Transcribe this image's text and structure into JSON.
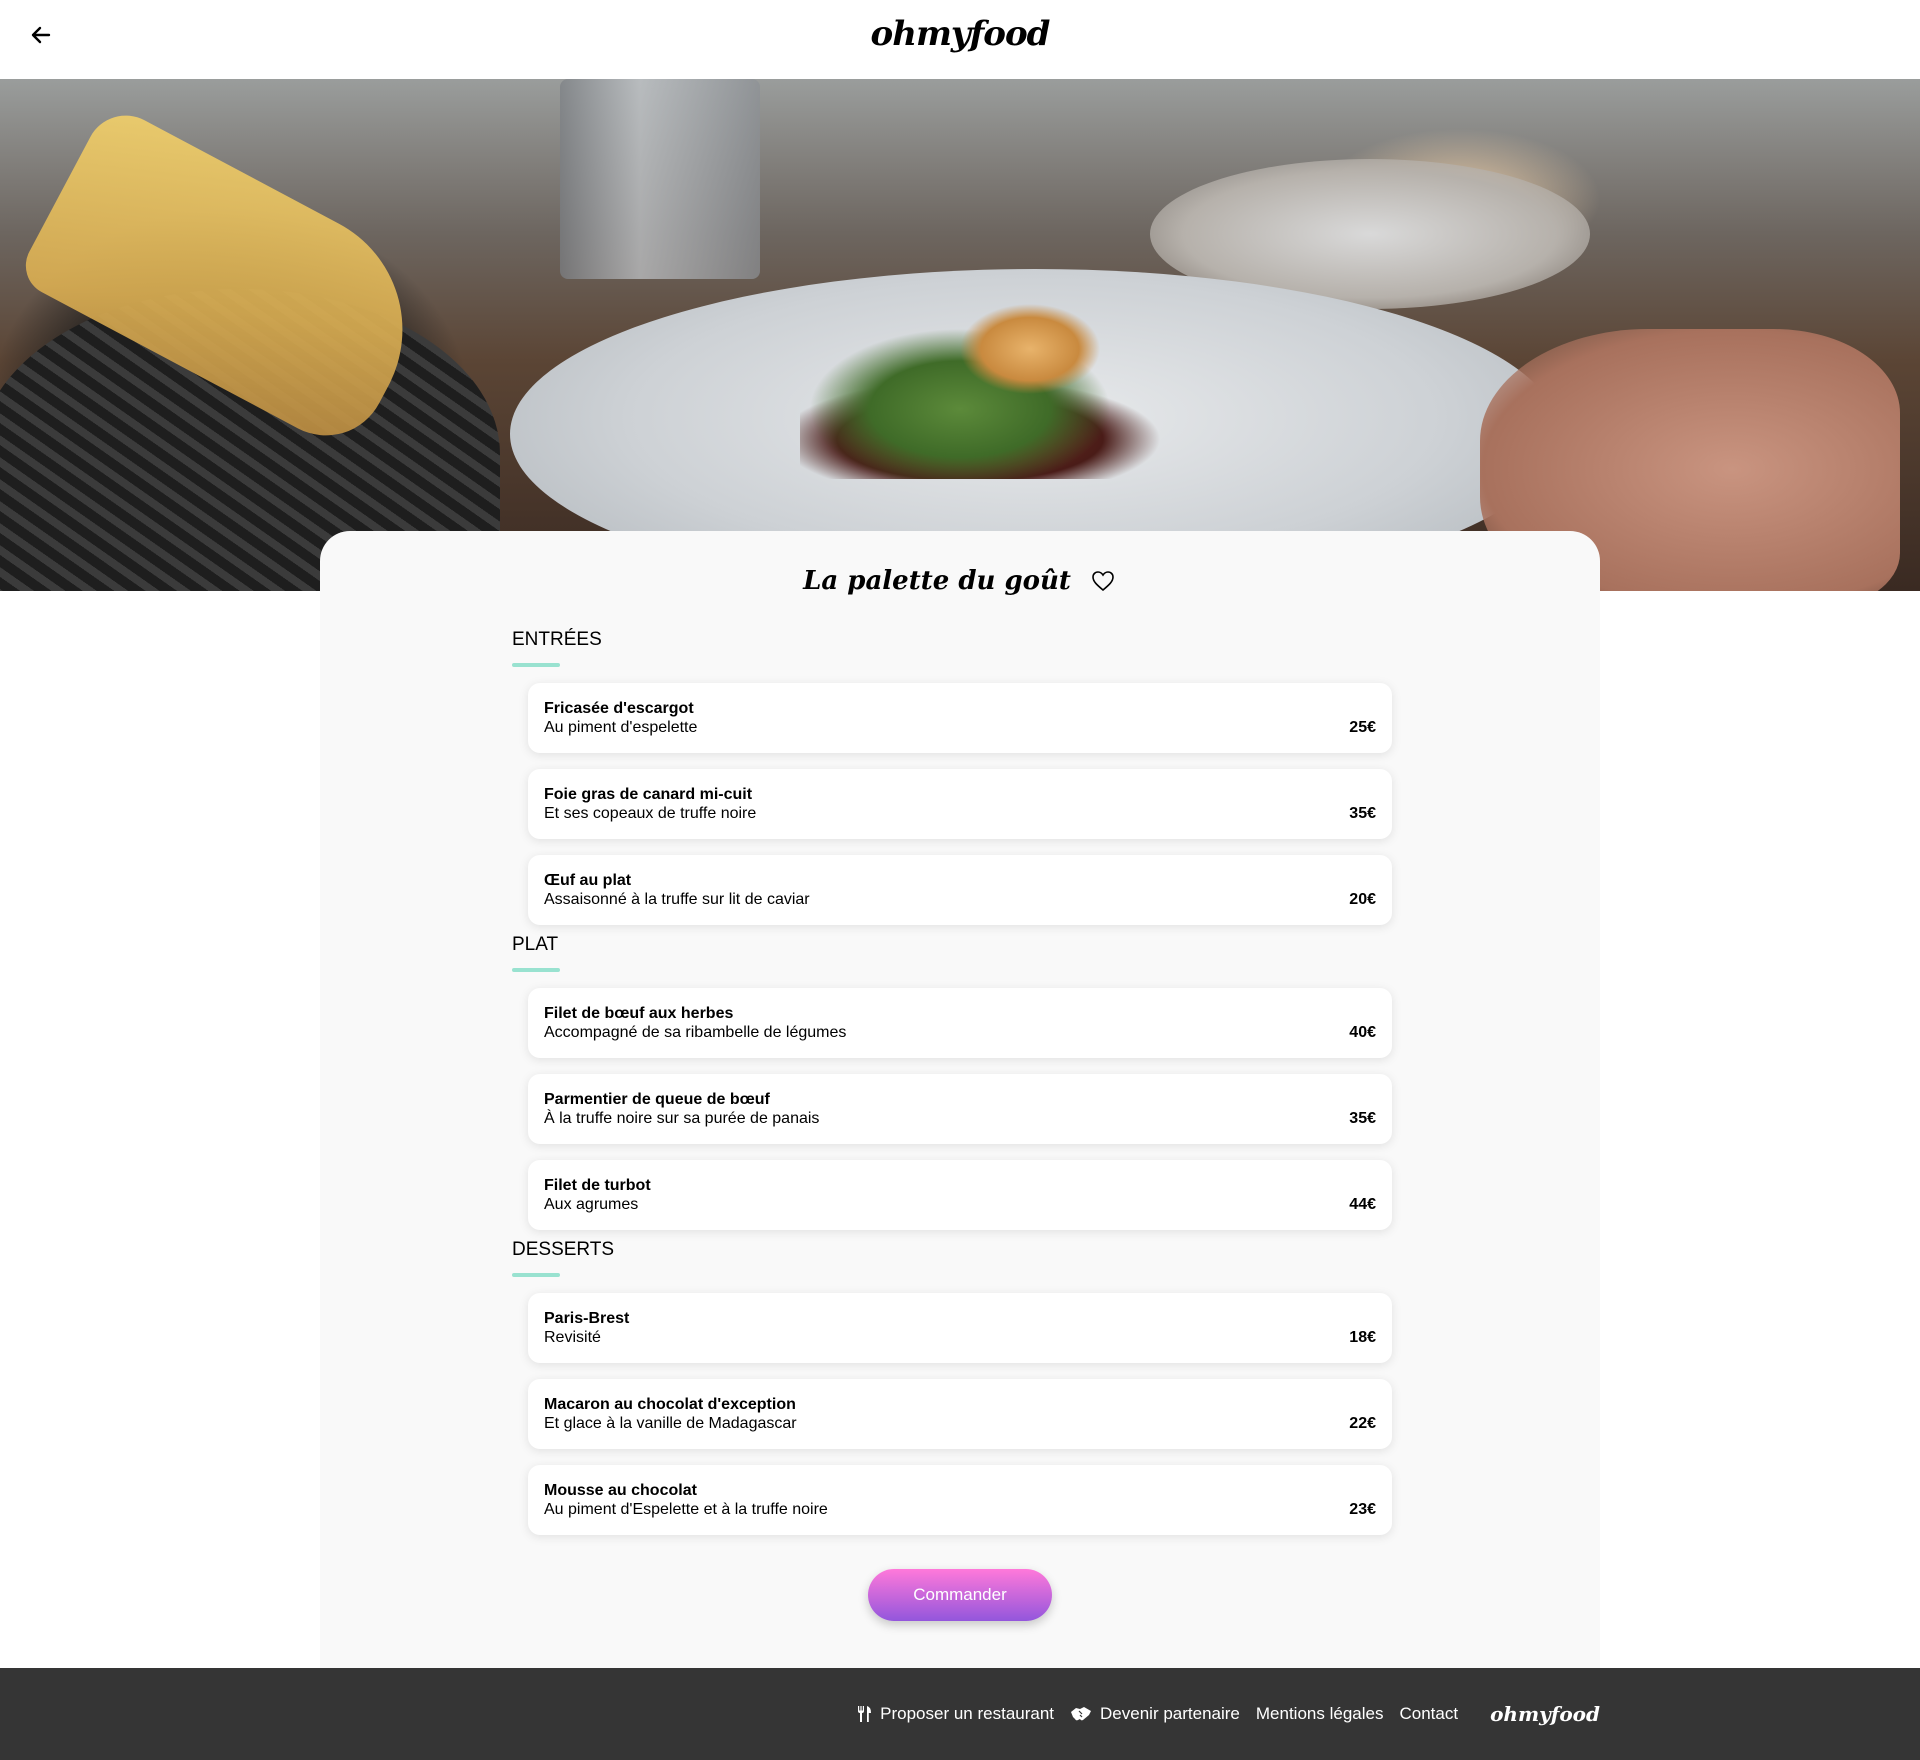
{
  "header": {
    "back_icon": "arrow-left-icon",
    "logo": "ohmyfood"
  },
  "hero": {
    "image": "restaurant-dish-photo"
  },
  "restaurant": {
    "name": "La palette du goût",
    "favorite_icon": "heart-icon"
  },
  "menu": {
    "entrees": {
      "title": "ENTRÉES",
      "dishes": [
        {
          "name": "Fricasée d'escargot",
          "description": "Au piment d'espelette",
          "price": "25€"
        },
        {
          "name": "Foie gras de canard mi-cuit",
          "description": "Et ses copeaux de truffe noire",
          "price": "35€"
        },
        {
          "name": "Œuf au plat",
          "description": "Assaisonné à la truffe sur lit de caviar",
          "price": "20€"
        }
      ]
    },
    "plat": {
      "title": "PLAT",
      "dishes": [
        {
          "name": "Filet de bœuf aux herbes",
          "description": "Accompagné de sa ribambelle de légumes",
          "price": "40€"
        },
        {
          "name": "Parmentier de queue de bœuf",
          "description": "À la truffe noire sur sa purée de panais",
          "price": "35€"
        },
        {
          "name": "Filet de turbot",
          "description": "Aux agrumes",
          "price": "44€"
        }
      ]
    },
    "desserts": {
      "title": "DESSERTS",
      "dishes": [
        {
          "name": "Paris-Brest",
          "description": "Revisité",
          "price": "18€"
        },
        {
          "name": "Macaron au chocolat d'exception",
          "description": "Et glace à la vanille de Madagascar",
          "price": "22€"
        },
        {
          "name": "Mousse au chocolat",
          "description": "Au piment d'Espelette et à la truffe noire",
          "price": "23€"
        }
      ]
    }
  },
  "order_button": "Commander",
  "footer": {
    "links": [
      {
        "label": "Proposer un restaurant",
        "icon": "utensils-icon"
      },
      {
        "label": "Devenir partenaire",
        "icon": "handshake-icon"
      },
      {
        "label": "Mentions légales"
      },
      {
        "label": "Contact"
      }
    ],
    "logo": "ohmyfood"
  },
  "colors": {
    "accent_underline": "#99e2d0",
    "button_gradient_top": "#ff79da",
    "button_gradient_bottom": "#9356dc",
    "footer_bg": "#353535",
    "card_bg": "#f9f9f9"
  }
}
